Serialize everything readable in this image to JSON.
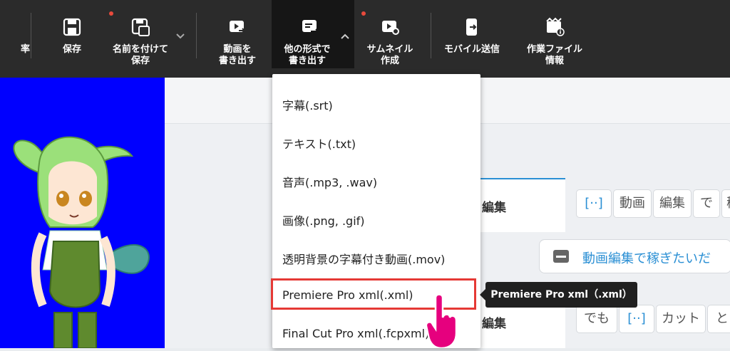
{
  "toolbar": {
    "items": [
      {
        "label": "率"
      },
      {
        "label": "保存"
      },
      {
        "label": "名前を付けて\n保存"
      },
      {
        "label": "動画を\n書き出す"
      },
      {
        "label": "他の形式で\n書き出す"
      },
      {
        "label": "サムネイル\n作成"
      },
      {
        "label": "モバイル送信"
      },
      {
        "label": "作業ファイル\n情報"
      }
    ]
  },
  "export_menu": {
    "items": [
      {
        "label": "字幕(.srt)"
      },
      {
        "label": "テキスト(.txt)"
      },
      {
        "label": "音声(.mp3, .wav)"
      },
      {
        "label": "画像(.png, .gif)"
      },
      {
        "label": "透明背景の字幕付き動画(.mov)"
      },
      {
        "label": "Premiere Pro xml(.xml)"
      },
      {
        "label": "Final Cut Pro xml(.fcpxml)"
      }
    ]
  },
  "tooltip": {
    "text": "Premiere Pro xml（.xml）"
  },
  "editor": {
    "row1_label": "編集",
    "row1_chips": [
      "[··]",
      "動画",
      "編集",
      "で",
      "稼"
    ],
    "subtitle_text": "動画編集で稼ぎたいだ",
    "row2_label": "編集",
    "row2_chips": [
      "でも",
      "[··]",
      "カット",
      "と"
    ]
  },
  "colors": {
    "accent": "#2a8fd4",
    "highlight": "#e53935",
    "preview_bg": "#0000ff",
    "cursor": "#e6007e"
  }
}
